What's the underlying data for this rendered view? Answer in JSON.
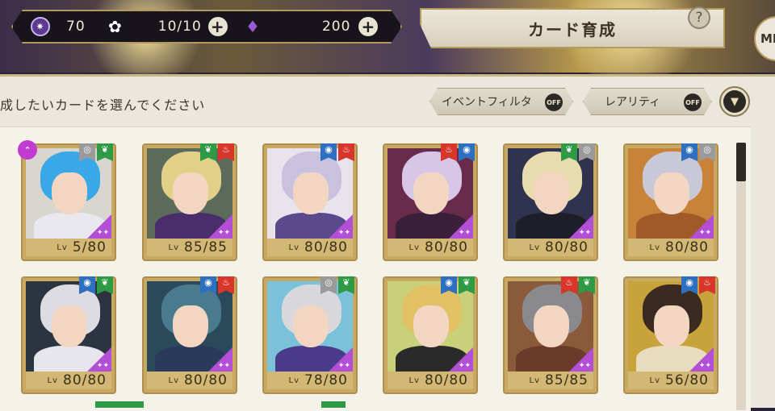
{
  "header": {
    "resources": [
      {
        "icon": "magic-gem-icon",
        "value": "70"
      },
      {
        "icon": "stamina-flower-icon",
        "value": "10/10"
      },
      {
        "icon": "crystal-icon",
        "value": "200"
      }
    ],
    "title": "カード育成",
    "help_label": "?",
    "menu_label": "ME"
  },
  "toolbar": {
    "instruction": "成したいカードを選んでください",
    "event_filter": {
      "label": "イベントフィルタ",
      "state": "OFF"
    },
    "rarity_filter": {
      "label": "レアリティ",
      "state": "OFF"
    }
  },
  "cards": [
    {
      "level": "5/80",
      "attrs": [
        "grey",
        "green"
      ],
      "hair": "#3aa8e6",
      "outfit": "#e8e8ee",
      "bg": "#d9d6cf",
      "boost": true
    },
    {
      "level": "85/85",
      "attrs": [
        "green",
        "red"
      ],
      "hair": "#e2d089",
      "outfit": "#4a2d6b",
      "bg": "#5b6a5a",
      "boost": false
    },
    {
      "level": "80/80",
      "attrs": [
        "blue",
        "red"
      ],
      "hair": "#c8c2de",
      "outfit": "#5a4a8c",
      "bg": "#e8e4ee",
      "boost": false
    },
    {
      "level": "80/80",
      "attrs": [
        "red",
        "blue"
      ],
      "hair": "#d8c6e8",
      "outfit": "#3a1f3a",
      "bg": "#6a2a4a",
      "boost": false
    },
    {
      "level": "80/80",
      "attrs": [
        "green",
        "grey"
      ],
      "hair": "#e8dcae",
      "outfit": "#1e1e28",
      "bg": "#2f3350",
      "boost": false
    },
    {
      "level": "80/80",
      "attrs": [
        "blue",
        "grey"
      ],
      "hair": "#c8c8d6",
      "outfit": "#a05a2a",
      "bg": "#c8823a",
      "boost": false
    },
    {
      "level": "80/80",
      "attrs": [
        "blue",
        "green"
      ],
      "hair": "#dcdce2",
      "outfit": "#e6e6ec",
      "bg": "#2c3442",
      "boost": false
    },
    {
      "level": "80/80",
      "attrs": [
        "blue",
        "red"
      ],
      "hair": "#4a7a8e",
      "outfit": "#2a3a5a",
      "bg": "#2a4a5c",
      "boost": false
    },
    {
      "level": "78/80",
      "attrs": [
        "grey",
        "green"
      ],
      "hair": "#d8d8dc",
      "outfit": "#4a3a8a",
      "bg": "#7ac2da",
      "boost": false
    },
    {
      "level": "80/80",
      "attrs": [
        "blue",
        "green"
      ],
      "hair": "#e2c064",
      "outfit": "#2a2a2a",
      "bg": "#c8d07a",
      "boost": false
    },
    {
      "level": "85/85",
      "attrs": [
        "red",
        "green"
      ],
      "hair": "#8a8a8e",
      "outfit": "#6a3a2a",
      "bg": "#8a5a3a",
      "boost": false
    },
    {
      "level": "56/80",
      "attrs": [
        "blue",
        "red"
      ],
      "hair": "#3a2a20",
      "outfit": "#e8dcc0",
      "bg": "#c8a23a",
      "boost": false
    }
  ],
  "level_prefix": "Lv",
  "colors": {
    "grey": "#9a9a9a",
    "green": "#2e9a46",
    "red": "#d8362a",
    "blue": "#2f6fc0"
  }
}
